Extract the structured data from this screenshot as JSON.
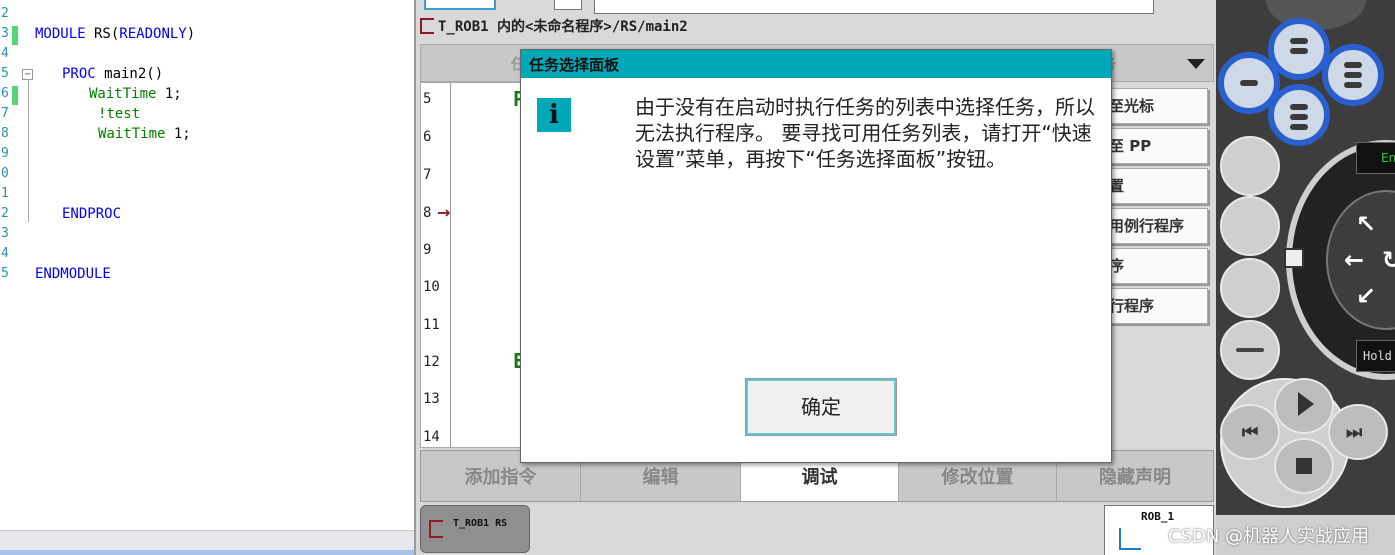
{
  "editor": {
    "lines": [
      {
        "num": "2",
        "text": ""
      },
      {
        "num": "3",
        "text": "MODULE RS(READONLY)"
      },
      {
        "num": "4",
        "text": ""
      },
      {
        "num": "5",
        "text": "PROC main2()"
      },
      {
        "num": "6",
        "text": "WaitTime 1;"
      },
      {
        "num": "7",
        "text": "!test"
      },
      {
        "num": "8",
        "text": "WaitTime 1;"
      },
      {
        "num": "9",
        "text": ""
      },
      {
        "num": "0",
        "text": ""
      },
      {
        "num": "1",
        "text": ""
      },
      {
        "num": "2",
        "text": "ENDPROC"
      },
      {
        "num": "3",
        "text": ""
      },
      {
        "num": "4",
        "text": ""
      },
      {
        "num": "5",
        "text": "ENDMODULE"
      }
    ],
    "tokens": {
      "module_kw": "MODULE",
      "module_name": " RS(",
      "readonly": "READONLY",
      "module_close": ")",
      "proc_kw": "PROC",
      "proc_name": " main2()",
      "wait1": "WaitTime",
      "wait1_arg": " 1;",
      "comment": "!test",
      "wait2": "WaitTime",
      "wait2_arg": " 1;",
      "endproc": "ENDPROC",
      "endmodule": "ENDMODULE"
    }
  },
  "pendant": {
    "path": "T_ROB1 内的<未命名程序>/RS/main2",
    "tab_left_fragment": "任",
    "tab_right_fragment": "务",
    "program_lines": [
      {
        "num": "5",
        "code": "P"
      },
      {
        "num": "6",
        "code": ""
      },
      {
        "num": "7",
        "code": ""
      },
      {
        "num": "8",
        "code": ""
      },
      {
        "num": "9",
        "code": ""
      },
      {
        "num": "10",
        "code": ""
      },
      {
        "num": "11",
        "code": ""
      },
      {
        "num": "12",
        "code": "E"
      },
      {
        "num": "13",
        "code": ""
      },
      {
        "num": "14",
        "code": ""
      }
    ],
    "side_buttons": [
      "至光标",
      "至 PP",
      "置",
      "用例行程序",
      "序",
      "行程序"
    ],
    "bottom_tabs": [
      {
        "label": "添加指令"
      },
      {
        "label": "编辑"
      },
      {
        "label": "调试"
      },
      {
        "label": "修改位置"
      },
      {
        "label": "隐藏声明"
      }
    ],
    "taskbar_label": "T_ROB1  RS",
    "rob_label": "ROB_1"
  },
  "dialog": {
    "title": "任务选择面板",
    "icon": "i",
    "message": "由于没有在启动时执行任务的列表中选择任务，所以无法执行程序。 要寻找可用任务列表，请打开“快速设置”菜单，再按下“任务选择面板”按钮。",
    "ok_label": "确定"
  },
  "joystick": {
    "en_label": "En",
    "hold_label": "Hold"
  },
  "watermark": "CSDN @机器人实战应用"
}
